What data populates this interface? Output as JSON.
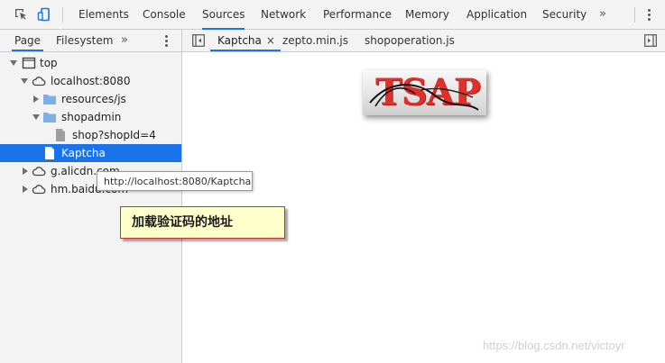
{
  "toolbar": {
    "tabs": [
      {
        "label": "Elements"
      },
      {
        "label": "Console"
      },
      {
        "label": "Sources"
      },
      {
        "label": "Network"
      },
      {
        "label": "Performance"
      },
      {
        "label": "Memory"
      },
      {
        "label": "Application"
      },
      {
        "label": "Security"
      }
    ],
    "more": "»",
    "active_tab": "Sources",
    "icons": {
      "inspect": "inspect-element-icon",
      "device": "device-toolbar-icon",
      "menu": "kebab-menu-icon"
    }
  },
  "navigator": {
    "tabs": [
      {
        "label": "Page"
      },
      {
        "label": "Filesystem"
      }
    ],
    "more": "»",
    "tree": [
      {
        "label": "top"
      },
      {
        "label": "localhost:8080"
      },
      {
        "label": "resources/js"
      },
      {
        "label": "shopadmin"
      },
      {
        "label": "shop?shopId=4"
      },
      {
        "label": "Kaptcha"
      },
      {
        "label": "g.alicdn.com"
      },
      {
        "label": "hm.baidu.com"
      }
    ]
  },
  "editor": {
    "tabs": [
      {
        "label": "Kaptcha"
      },
      {
        "label": "zepto.min.js"
      },
      {
        "label": "shopoperation.js"
      }
    ],
    "close_glyph": "×",
    "captcha_text": "TSAP"
  },
  "tooltip": {
    "text": "http://localhost:8080/Kaptcha"
  },
  "annotation": {
    "text": "加载验证码的地址"
  },
  "watermark": {
    "text": "https://blog.csdn.net/victoyr"
  },
  "colors": {
    "accent": "#1a73e8",
    "folder": "#7cb0e8",
    "callout_bg": "#ffffcc",
    "callout_border": "#c0392b",
    "captcha_text": "#e0302c"
  }
}
